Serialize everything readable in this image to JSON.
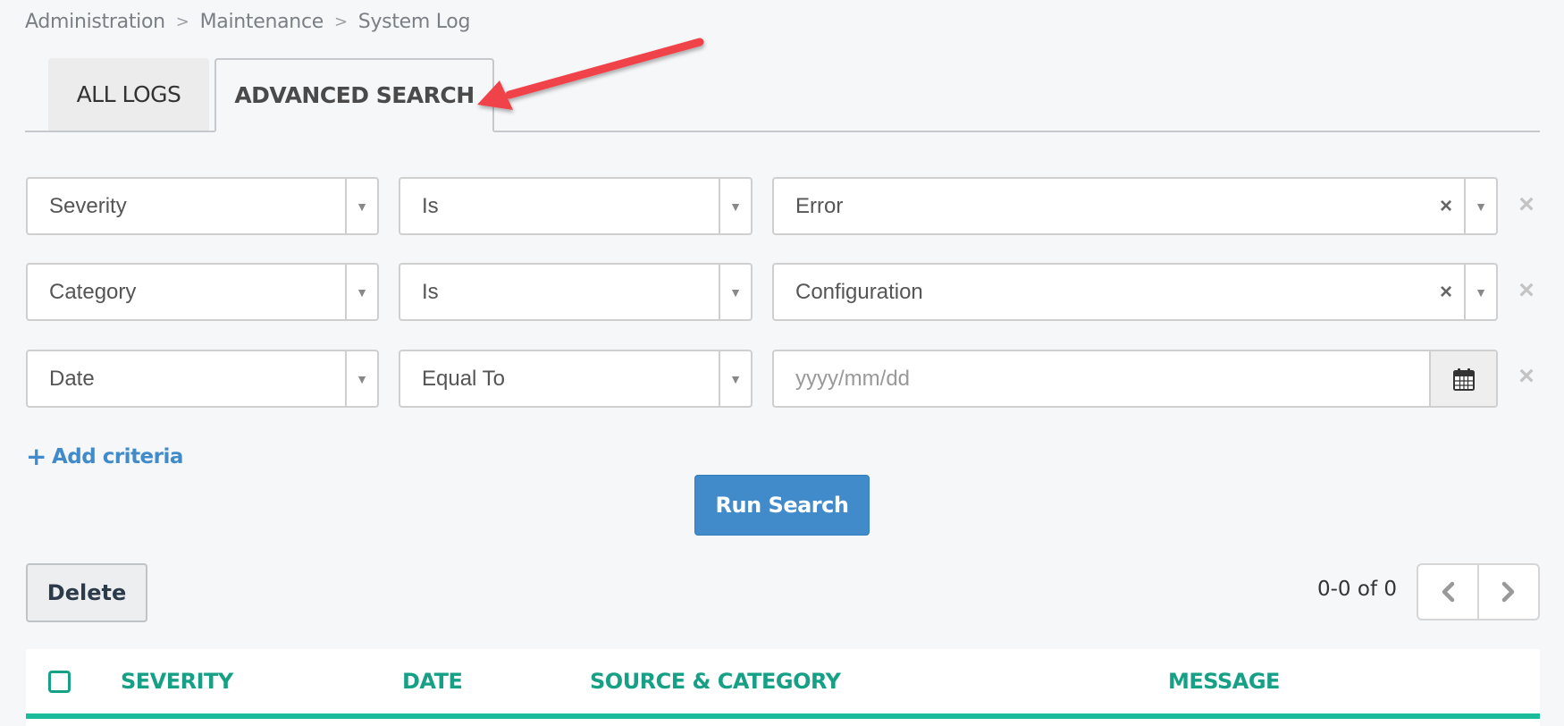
{
  "breadcrumb": [
    "Administration",
    "Maintenance",
    "System Log"
  ],
  "breadcrumb_separator": ">",
  "tabs": [
    {
      "label": "ALL LOGS",
      "active": false
    },
    {
      "label": "ADVANCED SEARCH",
      "active": true
    }
  ],
  "criteria": [
    {
      "field": "Severity",
      "operator": "Is",
      "value": "Error",
      "value_type": "select",
      "clear_icon": "×",
      "remove_icon": "×"
    },
    {
      "field": "Category",
      "operator": "Is",
      "value": "Configuration",
      "value_type": "select",
      "clear_icon": "×",
      "remove_icon": "×"
    },
    {
      "field": "Date",
      "operator": "Equal To",
      "value": "",
      "placeholder": "yyyy/mm/dd",
      "value_type": "date",
      "remove_icon": "×"
    }
  ],
  "caret_icon": "▼",
  "add_criteria": {
    "icon": "+",
    "label": "Add criteria"
  },
  "run_search_label": "Run Search",
  "delete_label": "Delete",
  "pagination": {
    "text": "0-0 of 0",
    "prev_icon": "chevron-left",
    "next_icon": "chevron-right"
  },
  "table": {
    "columns": [
      "SEVERITY",
      "DATE",
      "SOURCE & CATEGORY",
      "MESSAGE"
    ],
    "rows": []
  },
  "colors": {
    "primary": "#428bca",
    "table_accent": "#1abc9c",
    "table_header_text": "#16a085",
    "annotation_arrow": "#f0434a"
  }
}
